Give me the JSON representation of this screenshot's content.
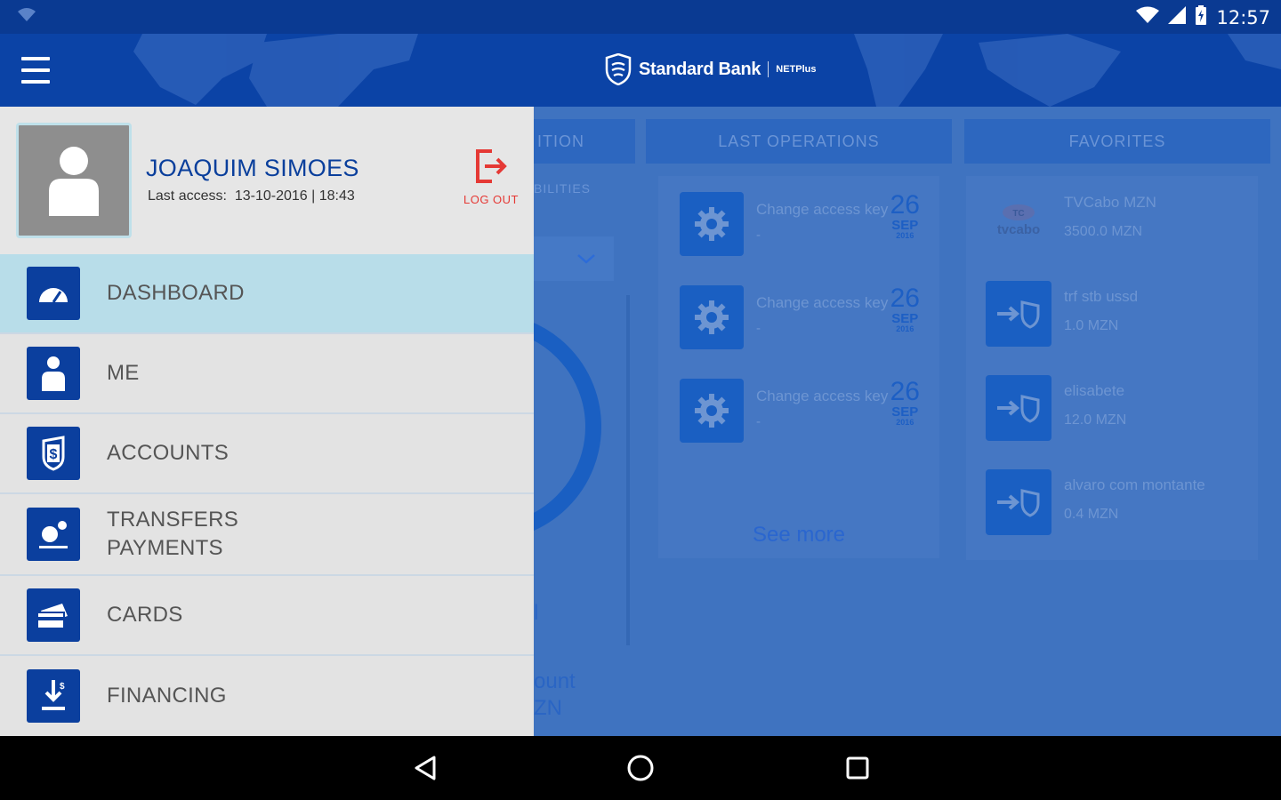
{
  "status_bar": {
    "time": "12:57"
  },
  "app_bar": {
    "brand_name": "Standard Bank",
    "brand_sub": "NETPlus"
  },
  "background": {
    "col1_header": "ITION",
    "col1_sub": "BILITIES",
    "col1_text_1": "l",
    "col1_text_2": "ount",
    "col1_text_3": "ZN",
    "last_operations": {
      "header": "LAST OPERATIONS",
      "items": [
        {
          "title": "Change access key",
          "detail": "-",
          "day": "26",
          "month": "SEP",
          "year": "2016"
        },
        {
          "title": "Change access key",
          "detail": "-",
          "day": "26",
          "month": "SEP",
          "year": "2016"
        },
        {
          "title": "Change access key",
          "detail": "-",
          "day": "26",
          "month": "SEP",
          "year": "2016"
        }
      ],
      "see_more": "See more"
    },
    "favorites": {
      "header": "FAVORITES",
      "tvcabo_logo": "tvcabo",
      "items": [
        {
          "name": "TVCabo MZN",
          "amount": "3500.0 MZN"
        },
        {
          "name": "trf stb ussd",
          "amount": "1.0 MZN"
        },
        {
          "name": "elisabete",
          "amount": "12.0 MZN"
        },
        {
          "name": "alvaro com montante",
          "amount": "0.4 MZN"
        }
      ]
    }
  },
  "drawer": {
    "user_name": "JOAQUIM SIMOES",
    "last_access_label": "Last access:",
    "last_access_value": "13-10-2016 | 18:43",
    "logout_label": "LOG OUT",
    "menu": [
      {
        "label": "DASHBOARD",
        "icon": "gauge-icon"
      },
      {
        "label": "ME",
        "icon": "person-icon"
      },
      {
        "label": "ACCOUNTS",
        "icon": "dollar-shield-icon"
      },
      {
        "label": "TRANSFERS",
        "label2": "PAYMENTS",
        "icon": "transfer-icon"
      },
      {
        "label": "CARDS",
        "icon": "card-icon"
      },
      {
        "label": "FINANCING",
        "icon": "financing-icon"
      }
    ]
  }
}
